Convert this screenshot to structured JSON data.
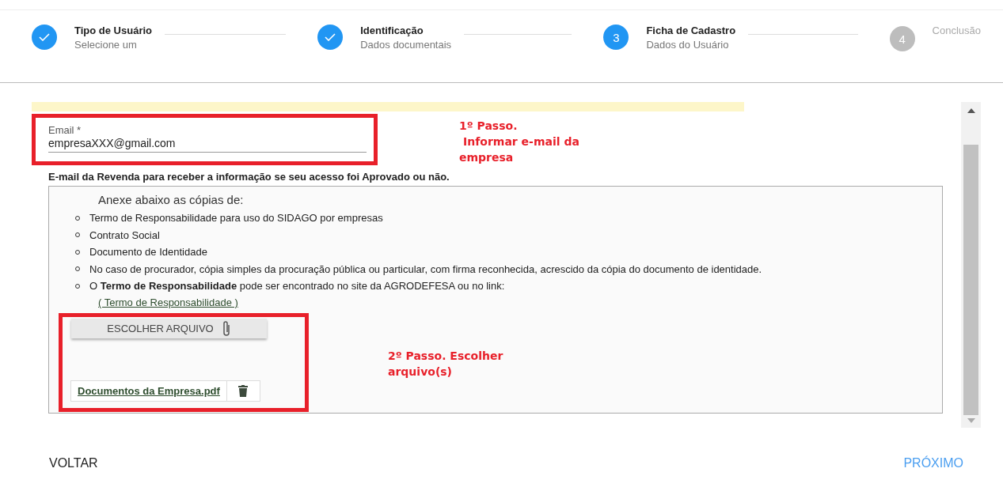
{
  "stepper": [
    {
      "title": "Tipo de Usuário",
      "subtitle": "Selecione um",
      "completed": true,
      "active": false
    },
    {
      "title": "Identificação",
      "subtitle": "Dados documentais",
      "completed": true,
      "active": false
    },
    {
      "number": "3",
      "title": "Ficha de Cadastro",
      "subtitle": "Dados do Usuário",
      "completed": false,
      "active": true
    },
    {
      "number": "4",
      "title": "Conclusão",
      "completed": false,
      "active": false
    }
  ],
  "email_field": {
    "label": "Email *",
    "value": "empresaXXX@gmail.com"
  },
  "annotation_1": [
    "1º Passo.",
    "Informar e-mail da",
    "empresa"
  ],
  "email_help": "E-mail da Revenda para receber a informação se seu acesso foi Aprovado ou não.",
  "attachments": {
    "heading": "Anexe abaixo as cópias de:",
    "items": [
      "Termo de Responsabilidade para uso do SIDAGO por empresas",
      "Contrato Social",
      "Documento de Identidade",
      "No caso de procurador, cópia simples da procuração pública ou particular, com firma reconhecida, acrescido da cópia do documento de identidade.",
      "O **Termo de Responsabilidade** pode ser encontrado no site da AGRODEFESA ou no link:"
    ],
    "link": "( Termo de Responsabilidade )",
    "choose_button": "ESCOLHER ARQUIVO",
    "files": [
      "Documentos da Empresa.pdf"
    ]
  },
  "annotation_2": [
    "2º Passo. Escolher",
    "arquivo(s)"
  ],
  "footer": {
    "back": "VOLTAR",
    "next": "PRÓXIMO"
  }
}
